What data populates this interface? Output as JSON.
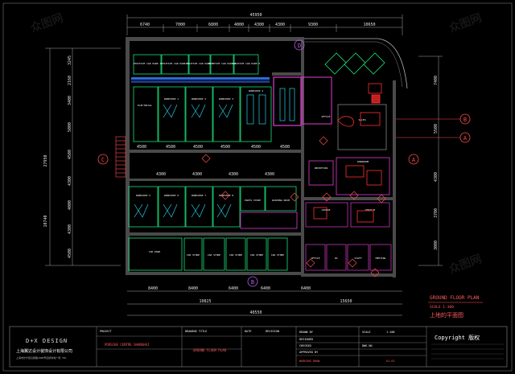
{
  "dimensions": {
    "top_overall": "45950",
    "top_segments": [
      "6740",
      "7000",
      "6800",
      "4000",
      "4300",
      "4300",
      "9300",
      "10650"
    ],
    "bottom_overall": "40550",
    "bottom_row2": [
      "10825",
      "15650"
    ],
    "bottom_segments": [
      "8400",
      "8400",
      "6400",
      "6400",
      "6400"
    ],
    "left_overall": "27950",
    "left_segments": [
      "3245",
      "2160",
      "3400",
      "5000",
      "4500",
      "4300",
      "4000",
      "4300",
      "4500"
    ],
    "left_lower": "10740",
    "right_segments": [
      "7400",
      "5500",
      "4300",
      "3700",
      "3000"
    ],
    "mid_row": [
      "4500",
      "4500",
      "4500",
      "4500",
      "4500",
      "4500"
    ],
    "mid_row2": [
      "4300",
      "4300",
      "4300",
      "4300"
    ]
  },
  "axis_markers": {
    "top": "D",
    "left": "C",
    "bottom": "B",
    "right_b": "B",
    "right_a": "A",
    "right_a2": "A"
  },
  "plan_title": {
    "english": "GROUND FLOOR PLAN",
    "scale": "SCALE 1:300",
    "chinese": "上地的平面图"
  },
  "rooms": {
    "parking": [
      "POSITIVE CAR PARK 1",
      "POSITIVE CAR PARK 2",
      "POSITIVE CAR PARK 3",
      "POSITIVE CAR PARK 4",
      "POSITIVE CAR PARK 5"
    ],
    "workshop_top": [
      "ELECTRICAL",
      "WORKSHOP 1",
      "WORKSHOP 2",
      "WORKSHOP 3",
      "WORKSHOP 4"
    ],
    "workshop_bottom": [
      "WORKSHOP 5",
      "WORKSHOP 6",
      "WORKSHOP 7",
      "WORKSHOP 8"
    ],
    "mid_labels": [
      "PARTS STORE",
      "WASHING ROOM",
      "OFFICE",
      "SALES"
    ],
    "bottom_rooms": [
      "CAR PARK",
      "CAR STORE",
      "CAR STORE",
      "CAR STORE",
      "CAR STORE",
      "CAR STORE"
    ],
    "right_rooms": [
      "RECEPTION",
      "SHOWROOM",
      "LOUNGE",
      "SERVICE",
      "OFFICE",
      "WC",
      "STAFF",
      "MEETING"
    ]
  },
  "title_block": {
    "company_en": "D+X DESIGN",
    "company_cn": "上海翼达设计装饰设计有限公司",
    "company_addr": "上海市长宁区虹桥路1000号虹桥商务广场 TEL",
    "project_label": "PROJECT",
    "project_name": "PORSCHE CENTRE   SHANGHAI",
    "drawing_label": "DRAWING TITLE",
    "drawing_name": "GROUND FLOOR PLAN",
    "date_label": "DATE",
    "revision_label": "REVISION",
    "drawn_by": "DRAWN BY",
    "designed": "DESIGNED",
    "checked": "CHECKED",
    "approved": "APPROVED BY",
    "scale_label": "SCALE",
    "scale_value": "1:100",
    "dwg_no_label": "DWG NO",
    "dwg_no": "A1-01",
    "status": "WORKING DRAW",
    "copyright": "Copyright 版权"
  },
  "watermark": "众图网"
}
